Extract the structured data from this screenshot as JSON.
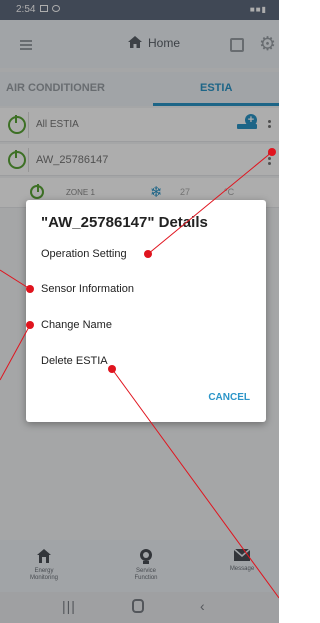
{
  "status_bar": {
    "time": "2:54"
  },
  "header": {
    "title": "Home"
  },
  "tabs": {
    "air_conditioner": "AIR CONDITIONER",
    "estia": "ESTIA"
  },
  "list": {
    "all_estia": "All ESTIA",
    "device": "AW_25786147",
    "zone_label": "ZONE 1",
    "zone_temp": "27",
    "zone_unit": "°C"
  },
  "dialog": {
    "title": "\"AW_25786147\" Details",
    "items": [
      "Operation Setting",
      "Sensor Information",
      "Change Name",
      "Delete ESTIA"
    ],
    "cancel": "CANCEL"
  },
  "bottom_nav": {
    "energy_line1": "Energy",
    "energy_line2": "Monitoring",
    "service_line1": "Service",
    "service_line2": "Function",
    "message": "Message"
  },
  "colors": {
    "accent": "#2b95c8",
    "power_green": "#5aa637",
    "callout_red": "#e0141e"
  },
  "icons": [
    "menu-icon",
    "home-icon",
    "calendar-icon",
    "gear-icon",
    "power-icon",
    "add-icon",
    "kebab-icon",
    "snowflake-icon",
    "energy-icon",
    "service-icon",
    "message-icon",
    "recents-icon",
    "home-circle-icon",
    "back-icon"
  ]
}
